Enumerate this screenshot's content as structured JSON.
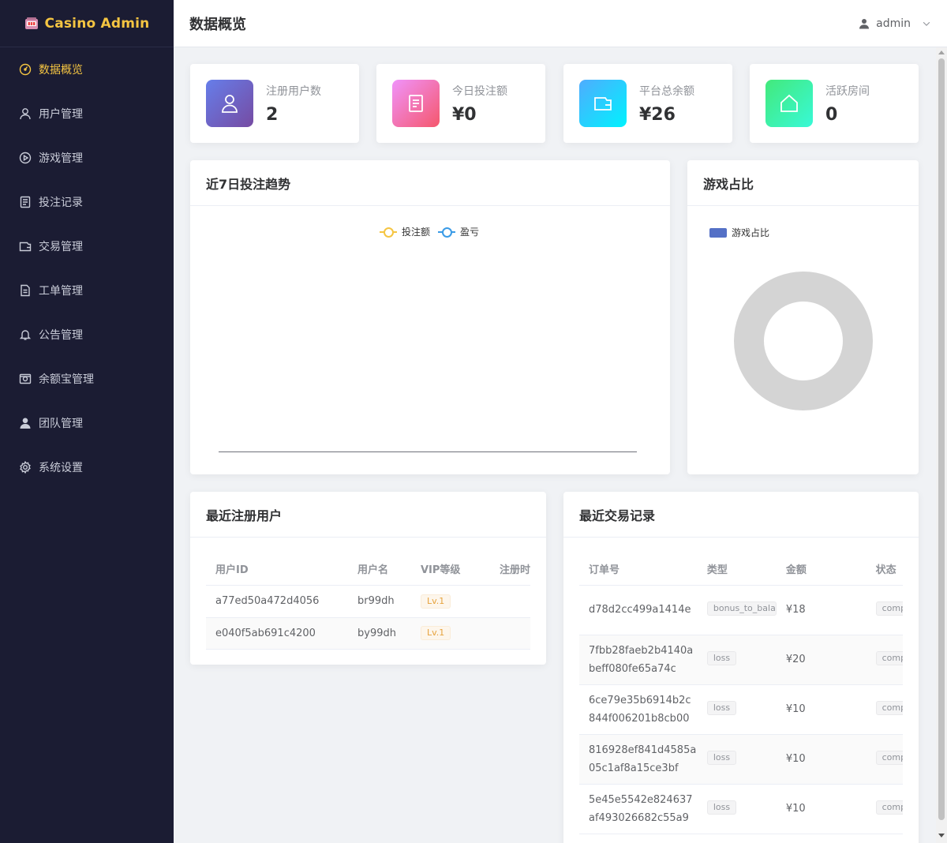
{
  "app": {
    "title": "Casino Admin"
  },
  "header": {
    "title": "数据概览",
    "user": "admin"
  },
  "sidebar": {
    "items": [
      {
        "label": "数据概览",
        "icon": "dashboard-icon",
        "active": true
      },
      {
        "label": "用户管理",
        "icon": "user-icon"
      },
      {
        "label": "游戏管理",
        "icon": "play-circle-icon"
      },
      {
        "label": "投注记录",
        "icon": "document-icon"
      },
      {
        "label": "交易管理",
        "icon": "wallet-icon"
      },
      {
        "label": "工单管理",
        "icon": "ticket-icon"
      },
      {
        "label": "公告管理",
        "icon": "bell-icon"
      },
      {
        "label": "余额宝管理",
        "icon": "safe-icon"
      },
      {
        "label": "团队管理",
        "icon": "team-icon"
      },
      {
        "label": "系统设置",
        "icon": "gear-icon"
      }
    ]
  },
  "stats": [
    {
      "label": "注册用户数",
      "value": "2",
      "icon": "user-icon",
      "color_from": "#667eea",
      "color_to": "#764ba2"
    },
    {
      "label": "今日投注额",
      "value": "¥0",
      "icon": "document-icon",
      "color_from": "#f093fb",
      "color_to": "#f5576c"
    },
    {
      "label": "平台总余额",
      "value": "¥26",
      "icon": "wallet-icon",
      "color_from": "#4facfe",
      "color_to": "#00f2fe"
    },
    {
      "label": "活跃房间",
      "value": "0",
      "icon": "home-icon",
      "color_from": "#43e97b",
      "color_to": "#38f9d7"
    }
  ],
  "trend": {
    "title": "近7日投注趋势",
    "legend": [
      {
        "name": "投注额",
        "color": "#f5c542"
      },
      {
        "name": "盈亏",
        "color": "#3a9be6"
      }
    ]
  },
  "game_share": {
    "title": "游戏占比",
    "legend": [
      {
        "name": "游戏占比",
        "color": "#5470c6"
      }
    ]
  },
  "chart_data": [
    {
      "type": "line",
      "title": "近7日投注趋势",
      "x": [],
      "series": [
        {
          "name": "投注额",
          "values": []
        },
        {
          "name": "盈亏",
          "values": []
        }
      ]
    },
    {
      "type": "pie",
      "title": "游戏占比",
      "series": [
        {
          "name": "游戏占比",
          "values": []
        }
      ]
    }
  ],
  "recent_users": {
    "title": "最近注册用户",
    "columns": [
      "用户ID",
      "用户名",
      "VIP等级",
      "注册时间"
    ],
    "rows": [
      {
        "id": "a77ed50a472d4056",
        "username": "br99dh",
        "vip": "Lv.1"
      },
      {
        "id": "e040f5ab691c4200",
        "username": "by99dh",
        "vip": "Lv.1"
      }
    ]
  },
  "recent_transactions": {
    "title": "最近交易记录",
    "columns": [
      "订单号",
      "类型",
      "金额",
      "状态"
    ],
    "rows": [
      {
        "order_line1": "d78d2cc499a1414e",
        "order_line2": "",
        "type": "bonus_to_balance",
        "amount": "¥18",
        "status": "completed"
      },
      {
        "order_line1": "7fbb28faeb2b4140a",
        "order_line2": "beff080fe65a74c",
        "type": "loss",
        "amount": "¥20",
        "status": "completed"
      },
      {
        "order_line1": "6ce79e35b6914b2c",
        "order_line2": "844f006201b8cb00",
        "type": "loss",
        "amount": "¥10",
        "status": "completed"
      },
      {
        "order_line1": "816928ef841d4585a",
        "order_line2": "05c1af8a15ce3bf",
        "type": "loss",
        "amount": "¥10",
        "status": "completed"
      },
      {
        "order_line1": "5e45e5542e824637",
        "order_line2": "af493026682c55a9",
        "type": "loss",
        "amount": "¥10",
        "status": "completed"
      }
    ]
  }
}
